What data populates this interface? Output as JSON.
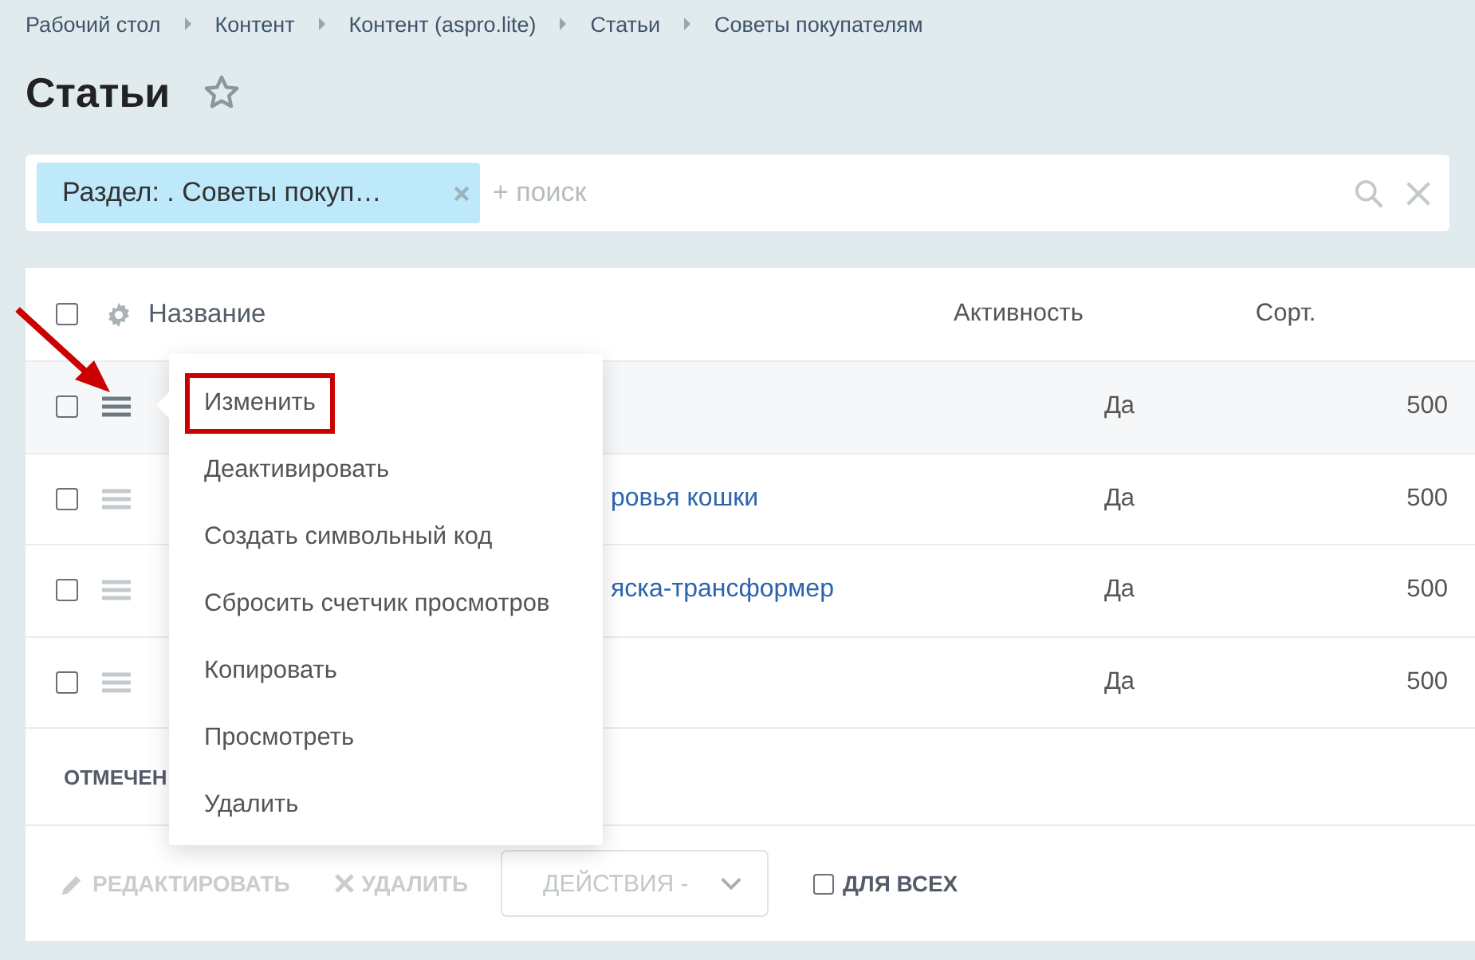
{
  "breadcrumbs": [
    "Рабочий стол",
    "Контент",
    "Контент (aspro.lite)",
    "Статьи",
    "Советы покупателям"
  ],
  "title": "Статьи",
  "filter": {
    "chip": "Раздел: . Советы покуп…",
    "placeholder": "+ поиск"
  },
  "table": {
    "columns": [
      "Название",
      "Активность",
      "Сорт."
    ],
    "all_checked": false,
    "rows": [
      {
        "name": "",
        "active": "Да",
        "sort": "500",
        "checked": false,
        "menu_open": true
      },
      {
        "name": "ровья кошки",
        "active": "Да",
        "sort": "500",
        "checked": false,
        "menu_open": false
      },
      {
        "name": "яска-трансформер",
        "active": "Да",
        "sort": "500",
        "checked": false,
        "menu_open": false
      },
      {
        "name": "",
        "active": "Да",
        "sort": "500",
        "checked": false,
        "menu_open": false
      }
    ]
  },
  "selection_label": "ОТМЕЧЕН",
  "footer": {
    "edit": {
      "label": "РЕДАКТИРОВАТЬ",
      "disabled": true
    },
    "delete": {
      "label": "УДАЛИТЬ",
      "disabled": true
    },
    "actions": "ДЕЙСТВИЯ -",
    "for_all": {
      "label": "ДЛЯ ВСЕХ",
      "checked": false
    }
  },
  "context_menu": [
    {
      "label": "Изменить",
      "outlined": true
    },
    {
      "label": "Деактивировать",
      "outlined": false
    },
    {
      "label": "Создать символьный код",
      "outlined": false
    },
    {
      "label": "Сбросить счетчик просмотров",
      "outlined": false
    },
    {
      "label": "Копировать",
      "outlined": false
    },
    {
      "label": "Просмотреть",
      "outlined": false
    },
    {
      "label": "Удалить",
      "outlined": false
    }
  ]
}
